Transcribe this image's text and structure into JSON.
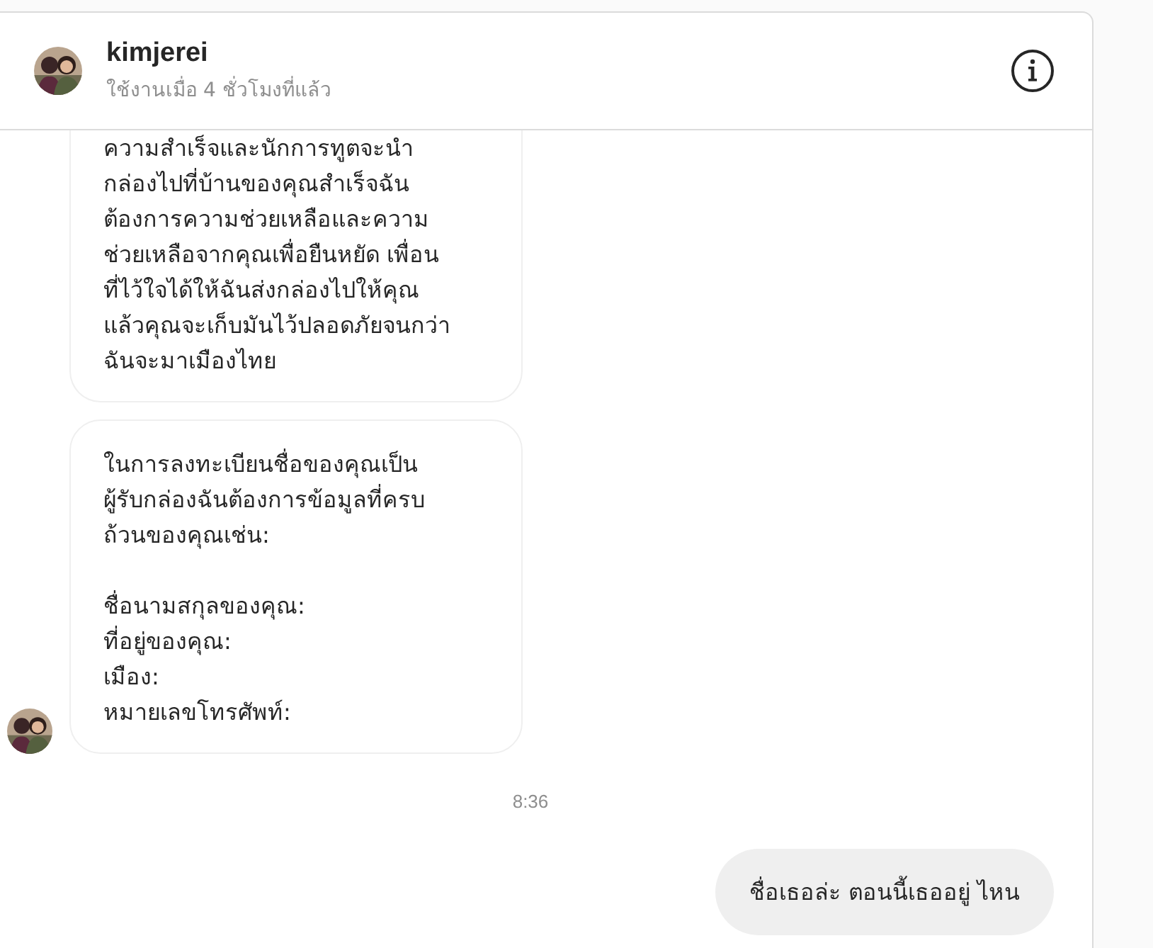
{
  "header": {
    "name": "kimjerei",
    "status": "ใช้งานเมื่อ 4 ชั่วโมงที่แล้ว"
  },
  "messages": [
    {
      "kind": "incoming",
      "cut_off": true,
      "avatar": false,
      "text": "ความสำเร็จและนักการทูตจะนำ\nกล่องไปที่บ้านของคุณสำเร็จฉัน\nต้องการความช่วยเหลือและความ\nช่วยเหลือจากคุณเพื่อยืนหยัด เพื่อน\nที่ไว้ใจได้ให้ฉันส่งกล่องไปให้คุณ\nแล้วคุณจะเก็บมันไว้ปลอดภัยจนกว่า\nฉันจะมาเมืองไทย"
    },
    {
      "kind": "incoming",
      "cut_off": false,
      "avatar": true,
      "text": "ในการลงทะเบียนชื่อของคุณเป็น\nผู้รับกล่องฉันต้องการข้อมูลที่ครบ\nถ้วนของคุณเช่น:\n\nชื่อนามสกุลของคุณ:\nที่อยู่ของคุณ:\nเมือง:\nหมายเลขโทรศัพท์:"
    },
    {
      "kind": "timestamp",
      "text": "8:36"
    },
    {
      "kind": "outgoing",
      "text": "ชื่อเธอล่ะ ตอนนี้เธออยู่ ไหน"
    }
  ]
}
